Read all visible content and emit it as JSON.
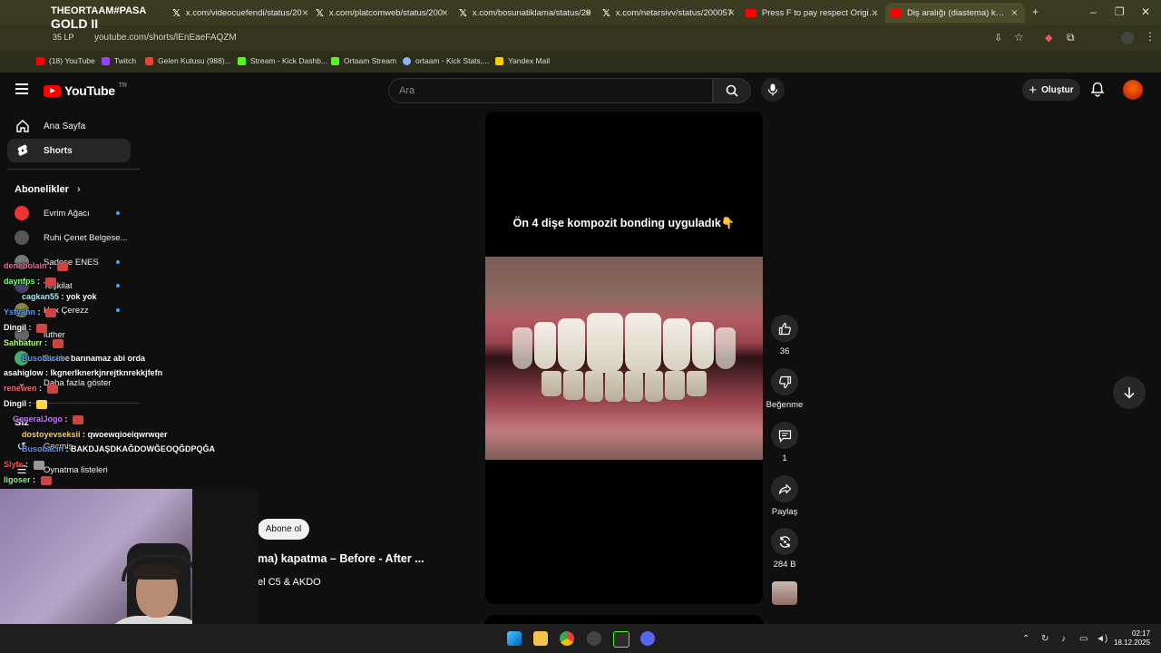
{
  "browser": {
    "tabs": [
      {
        "label": "THEORTAAM#PASA",
        "type": "x"
      },
      {
        "label": "x.com/videocuefendi/status/20",
        "type": "x"
      },
      {
        "label": "x.com/platcomweb/status/200",
        "type": "x"
      },
      {
        "label": "x.com/bosunatiklama/status/20",
        "type": "x"
      },
      {
        "label": "x.com/netarsivv/status/200057",
        "type": "x"
      },
      {
        "label": "Press F to pay respect Origin -",
        "type": "yt"
      },
      {
        "label": "Diş aralığı (diastema) kapat",
        "type": "yt",
        "active": true
      }
    ],
    "overlay_rank": "GOLD II",
    "overlay_lp": "35 LP",
    "url": "youtube.com/shorts/lEnEaeFAQZM",
    "bookmarks": [
      {
        "label": "(18) YouTube",
        "color": "#ff0000"
      },
      {
        "label": "Twitch",
        "color": "#9146ff"
      },
      {
        "label": "Gelen Kutusu (988)...",
        "color": "#ea4335"
      },
      {
        "label": "Stream - Kick Dashb...",
        "color": "#53fc18"
      },
      {
        "label": "Ortaam Stream",
        "color": "#53fc18"
      },
      {
        "label": "ortaam - Kick Stats,...",
        "color": "#8ab4f8"
      },
      {
        "label": "Yandex Mail",
        "color": "#ffcc00"
      }
    ]
  },
  "youtube": {
    "logo": "YouTube",
    "region": "TR",
    "search_placeholder": "Ara",
    "create_label": "Oluştur",
    "nav": [
      {
        "label": "Ana Sayfa",
        "icon": "home-icon"
      },
      {
        "label": "Shorts",
        "icon": "shorts-icon",
        "selected": true
      }
    ],
    "subs_heading": "Abonelikler",
    "subscriptions": [
      {
        "label": "Evrim Ağacı",
        "color": "#e33"
      },
      {
        "label": "Ruhi Çenet Belgese...",
        "color": "#555"
      },
      {
        "label": "Sadece ENES",
        "color": "#777"
      },
      {
        "label": "Teşkilat",
        "color": "#446"
      },
      {
        "label": "Hux Çerezz",
        "color": "#884"
      },
      {
        "label": "luther",
        "color": "#666"
      },
      {
        "label": "Bisebe",
        "color": "#4a7"
      }
    ],
    "show_more": "Daha fazla göster",
    "you_heading": "Siz",
    "history": "Geçmiş",
    "playlists": "Oynatma listeleri"
  },
  "short": {
    "caption": "Ön 4 dişe kompozit bonding uyguladık👇",
    "subscribe_label": "Abone ol",
    "title": "ma) kapatma – Before - After ...",
    "channel": "el C5 & AKDO",
    "actions": {
      "like_count": "36",
      "dislike_label": "Beğenme",
      "comment_count": "1",
      "share_label": "Paylaş",
      "remix_count": "284 B"
    }
  },
  "chat": [
    {
      "user": "denebolain",
      "text": "",
      "color": "#ff5ea3"
    },
    {
      "user": "daynfps",
      "text": "",
      "color": "#7dff7d"
    },
    {
      "user": "cagkan55",
      "text": " : yok yok",
      "color": "#9ef"
    },
    {
      "user": "Ysfyahn",
      "text": "",
      "color": "#5b9bff"
    },
    {
      "user": "Dingil",
      "text": "",
      "color": "#fff"
    },
    {
      "user": "Sahbaturr",
      "text": "",
      "color": "#b0ff7a"
    },
    {
      "user": "Busobacin",
      "text": " : barınamaz abi orda",
      "color": "#5b9bff"
    },
    {
      "user": "asahiglow",
      "text": " : lkgnerlknerkjnrejtknrekkjfefn",
      "color": "#fff"
    },
    {
      "user": "renewen",
      "text": "",
      "color": "#ff6a6a"
    },
    {
      "user": "Dingil",
      "text": "",
      "color": "#fff"
    },
    {
      "user": "GeneralJogo",
      "text": "",
      "color": "#c77dff"
    },
    {
      "user": "dostoyevseksii",
      "text": " : qwoewqioeiqwrwqer",
      "color": "#ffd54a"
    },
    {
      "user": "Busobacin",
      "text": " : BAKDJAŞDKAĞDOWĞEOQĞDPQĞA",
      "color": "#5b9bff"
    },
    {
      "user": "Slyfe",
      "text": "",
      "color": "#ff4b4b"
    },
    {
      "user": "ligoser",
      "text": "",
      "color": "#7dff7d"
    }
  ],
  "taskbar": {
    "time": "02:17",
    "date": "18.12.2025"
  }
}
